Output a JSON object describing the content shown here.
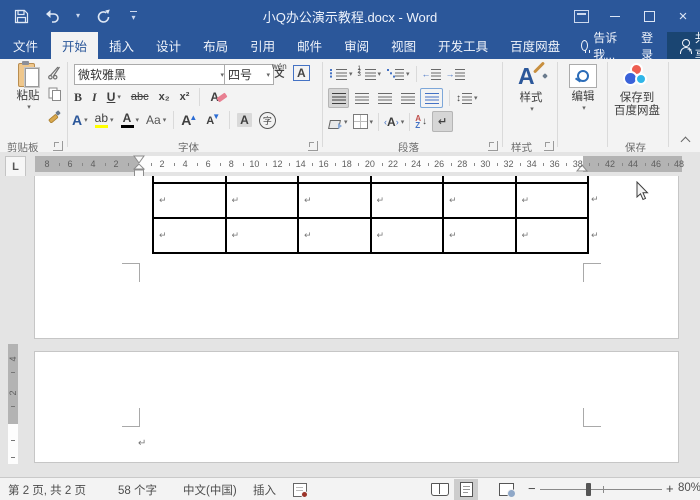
{
  "window": {
    "title": "小Q办公演示教程.docx - Word"
  },
  "tabs": {
    "file": "文件",
    "active": "开始",
    "items": [
      "开始",
      "插入",
      "设计",
      "布局",
      "引用",
      "邮件",
      "审阅",
      "视图",
      "开发工具",
      "百度网盘"
    ],
    "tellme": "告诉我...",
    "signin": "登录",
    "share": "共享"
  },
  "ribbon": {
    "clipboard": {
      "group_label": "剪贴板",
      "paste_label": "粘贴"
    },
    "font": {
      "group_label": "字体",
      "font_name": "微软雅黑",
      "font_size": "四号",
      "bold": "B",
      "italic": "I",
      "underline": "U",
      "strikethrough": "abc",
      "subscript": "x₂",
      "superscript": "x²",
      "clear_format": "A",
      "text_effects": "A",
      "highlight": "ab",
      "font_color": "A",
      "change_case": "Aa",
      "grow_font": "A",
      "shrink_font": "A",
      "char_shading": "A",
      "enclose_char": "字",
      "phonetic_top": "wén",
      "phonetic_bottom": "文",
      "char_border": "A"
    },
    "paragraph": {
      "group_label": "段落",
      "sort_a": "A",
      "sort_z": "Z",
      "scale_a": "A",
      "linespace_arrow": "↕",
      "outdent_arrow": "←",
      "indent_arrow": "→",
      "marks_icon": "↵"
    },
    "styles": {
      "group_label": "样式",
      "button_label": "样式"
    },
    "editing": {
      "button_label": "编辑"
    },
    "save": {
      "group_label": "保存",
      "button_line1": "保存到",
      "button_line2": "百度网盘"
    }
  },
  "ruler": {
    "tab_selector": "L",
    "left_numbers": [
      "8",
      "6",
      "4",
      "2"
    ],
    "mid_numbers": [
      "2",
      "4",
      "6",
      "8",
      "10",
      "12",
      "14",
      "16",
      "18",
      "20",
      "22",
      "24",
      "26",
      "28",
      "30",
      "32",
      "34",
      "36",
      "38"
    ],
    "right_numbers": [
      "42",
      "44",
      "46",
      "48"
    ],
    "v_numbers": [
      "4",
      "2"
    ]
  },
  "document": {
    "paragraph_mark": "↵",
    "table": {
      "columns": 6,
      "body_rows": 2
    }
  },
  "status": {
    "page_info": "第 2 页, 共 2 页",
    "word_count": "58 个字",
    "language": "中文(中国)",
    "insert_mode": "插入",
    "zoom_minus": "−",
    "zoom_plus": "+",
    "zoom_level": "80%"
  },
  "colors": {
    "titlebar_blue": "#2b579a",
    "share_chip": "#1a4572",
    "highlight_yellow": "#ffff00",
    "font_color_bar": "#000000",
    "selected_chip": "#d6d6d6",
    "table_border": "#000000"
  }
}
